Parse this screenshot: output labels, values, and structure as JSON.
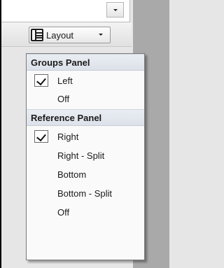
{
  "toolbar": {
    "layout_label": "Layout"
  },
  "groups_panel": {
    "header": "Groups Panel",
    "items": [
      {
        "label": "Left",
        "checked": true
      },
      {
        "label": "Off",
        "checked": false
      }
    ]
  },
  "reference_panel": {
    "header": "Reference Panel",
    "items": [
      {
        "label": "Right",
        "checked": true
      },
      {
        "label": "Right - Split",
        "checked": false
      },
      {
        "label": "Bottom",
        "checked": false
      },
      {
        "label": "Bottom - Split",
        "checked": false
      },
      {
        "label": "Off",
        "checked": false
      }
    ]
  }
}
